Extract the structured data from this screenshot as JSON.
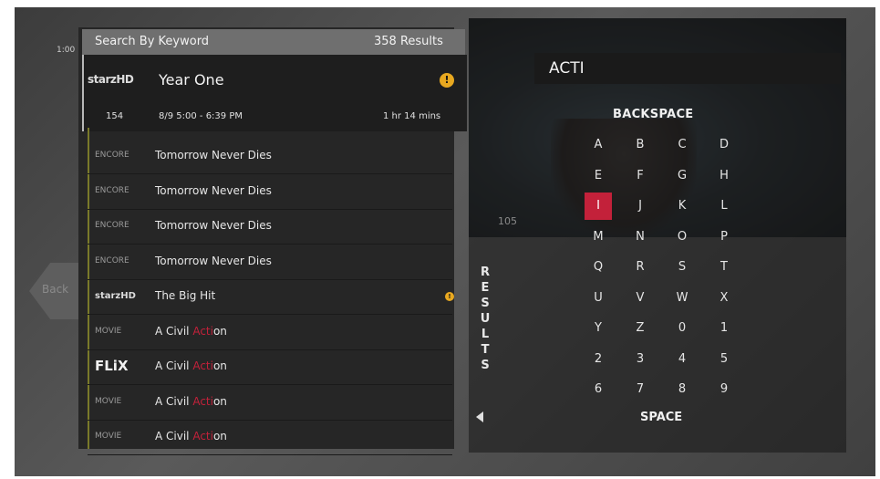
{
  "timestamp": "1:00",
  "back_label": "Back",
  "background_channel": "105",
  "search": {
    "header_title": "Search By Keyword",
    "results_count": "358 Results",
    "query": "ACTI"
  },
  "selected_result": {
    "channel_logo": "starzHD",
    "title": "Year One",
    "warning_icon": "!",
    "channel_number": "154",
    "airtime": "8/9 5:00 - 6:39 PM",
    "duration": "1 hr 14 mins"
  },
  "results": [
    {
      "logo": "ENCORE",
      "title": "Tomorrow Never Dies",
      "pre": "",
      "match": "",
      "post": "",
      "warning": false
    },
    {
      "logo": "ENCORE",
      "title": "Tomorrow Never Dies",
      "pre": "",
      "match": "",
      "post": "",
      "warning": false
    },
    {
      "logo": "ENCORE",
      "title": "Tomorrow Never Dies",
      "pre": "",
      "match": "",
      "post": "",
      "warning": false
    },
    {
      "logo": "ENCORE",
      "title": "Tomorrow Never Dies",
      "pre": "",
      "match": "",
      "post": "",
      "warning": false
    },
    {
      "logo": "starzHD",
      "title": "The Big Hit",
      "pre": "",
      "match": "",
      "post": "",
      "warning": true,
      "warning_icon": "!"
    },
    {
      "logo": "MOVIE",
      "title": "",
      "pre": "A Civil ",
      "match": "Acti",
      "post": "on",
      "warning": false
    },
    {
      "logo": "FLiX",
      "title": "",
      "pre": "A Civil ",
      "match": "Acti",
      "post": "on",
      "warning": false
    },
    {
      "logo": "MOVIE",
      "title": "",
      "pre": "A Civil ",
      "match": "Acti",
      "post": "on",
      "warning": false
    },
    {
      "logo": "MOVIE",
      "title": "",
      "pre": "A Civil ",
      "match": "Acti",
      "post": "on",
      "warning": false
    }
  ],
  "results_tab_letters": [
    "R",
    "E",
    "S",
    "U",
    "L",
    "T",
    "S"
  ],
  "keyboard": {
    "backspace_label": "BACKSPACE",
    "space_label": "SPACE",
    "selected_key": "I",
    "rows": [
      [
        "A",
        "B",
        "C",
        "D"
      ],
      [
        "E",
        "F",
        "G",
        "H"
      ],
      [
        "I",
        "J",
        "K",
        "L"
      ],
      [
        "M",
        "N",
        "O",
        "P"
      ],
      [
        "Q",
        "R",
        "S",
        "T"
      ],
      [
        "U",
        "V",
        "W",
        "X"
      ],
      [
        "Y",
        "Z",
        "0",
        "1"
      ],
      [
        "2",
        "3",
        "4",
        "5"
      ],
      [
        "6",
        "7",
        "8",
        "9"
      ]
    ]
  },
  "colors": {
    "highlight": "#c3213a",
    "warning": "#e8a820",
    "header_bar": "#6f6f6f"
  }
}
